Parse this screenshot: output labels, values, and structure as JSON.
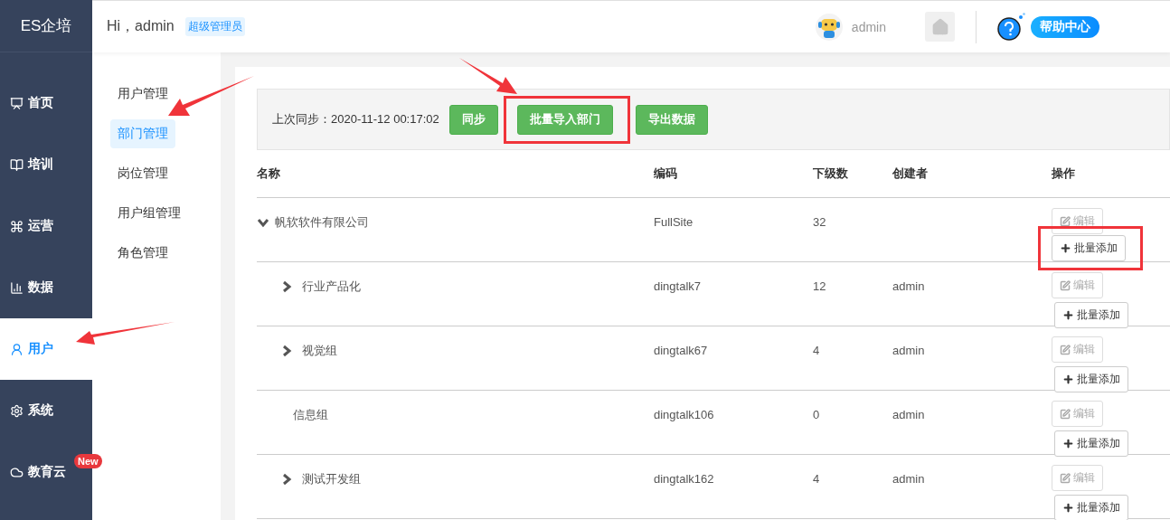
{
  "brand": "ES企培",
  "header": {
    "greeting": "Hi，admin",
    "role_badge": "超级管理员",
    "user_name": "admin",
    "help_label": "帮助中心"
  },
  "nav": [
    {
      "label": "首页",
      "selected": false
    },
    {
      "label": "培训",
      "selected": false
    },
    {
      "label": "运营",
      "selected": false
    },
    {
      "label": "数据",
      "selected": false
    },
    {
      "label": "用户",
      "selected": true
    },
    {
      "label": "系统",
      "selected": false
    },
    {
      "label": "教育云",
      "selected": false,
      "badge": "New"
    }
  ],
  "subnav": [
    {
      "label": "用户管理",
      "selected": false
    },
    {
      "label": "部门管理",
      "selected": true
    },
    {
      "label": "岗位管理",
      "selected": false
    },
    {
      "label": "用户组管理",
      "selected": false
    },
    {
      "label": "角色管理",
      "selected": false
    }
  ],
  "toolbar": {
    "sync_text": "上次同步：2020-11-12 00:17:02",
    "buttons": [
      {
        "label": "同步",
        "highlighted": false
      },
      {
        "label": "批量导入部门",
        "highlighted": true
      },
      {
        "label": "导出数据",
        "highlighted": false
      }
    ]
  },
  "table": {
    "columns": [
      "名称",
      "编码",
      "下级数",
      "创建者",
      "操作"
    ],
    "rows": [
      {
        "name": "帆软软件有限公司",
        "code": "FullSite",
        "count": "32",
        "creator": "",
        "expanded": true,
        "edit": {
          "label": "编辑",
          "disabled": true
        },
        "add": {
          "label": "批量添加",
          "highlighted": true
        },
        "children": [
          {
            "name": "行业产品化",
            "code": "dingtalk7",
            "count": "12",
            "creator": "admin",
            "expanded": false,
            "edit": {
              "label": "编辑",
              "disabled": true
            },
            "add": {
              "label": "批量添加",
              "highlighted": false
            }
          },
          {
            "name": "视觉组",
            "code": "dingtalk67",
            "count": "4",
            "creator": "admin",
            "expanded": false,
            "edit": {
              "label": "编辑",
              "disabled": true
            },
            "add": {
              "label": "批量添加",
              "highlighted": false
            }
          },
          {
            "name": "信息组",
            "code": "dingtalk106",
            "count": "0",
            "creator": "admin",
            "kind": "leaf",
            "edit": {
              "label": "编辑",
              "disabled": true
            },
            "add": {
              "label": "批量添加",
              "highlighted": false
            }
          },
          {
            "name": "测试开发组",
            "code": "dingtalk162",
            "count": "4",
            "creator": "admin",
            "expanded": false,
            "edit": {
              "label": "编辑",
              "disabled": true
            },
            "add": {
              "label": "批量添加",
              "highlighted": false
            }
          }
        ]
      }
    ]
  }
}
